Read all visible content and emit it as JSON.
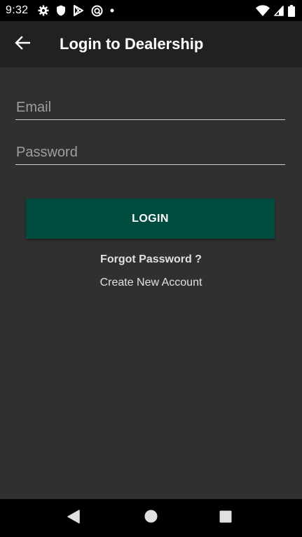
{
  "status_bar": {
    "time": "9:32",
    "left_icons": [
      "gear-icon",
      "shield-icon",
      "play-store-icon",
      "sync-icon",
      "dot-icon"
    ],
    "right_icons": [
      "wifi-icon",
      "signal-icon",
      "battery-icon"
    ]
  },
  "app_bar": {
    "back_icon": "arrow-left-icon",
    "title": "Login to Dealership"
  },
  "form": {
    "email_placeholder": "Email",
    "email_value": "",
    "password_placeholder": "Password",
    "password_value": "",
    "login_label": "LOGIN",
    "forgot_label": "Forgot Password ?",
    "create_label": "Create New Account"
  },
  "nav_bar": {
    "icons": [
      "nav-back-icon",
      "nav-home-icon",
      "nav-recents-icon"
    ]
  },
  "colors": {
    "background": "#303030",
    "app_bar": "#212121",
    "status_bar": "#000000",
    "accent": "#004d40",
    "text": "#ffffff",
    "hint": "#9e9e9e"
  }
}
